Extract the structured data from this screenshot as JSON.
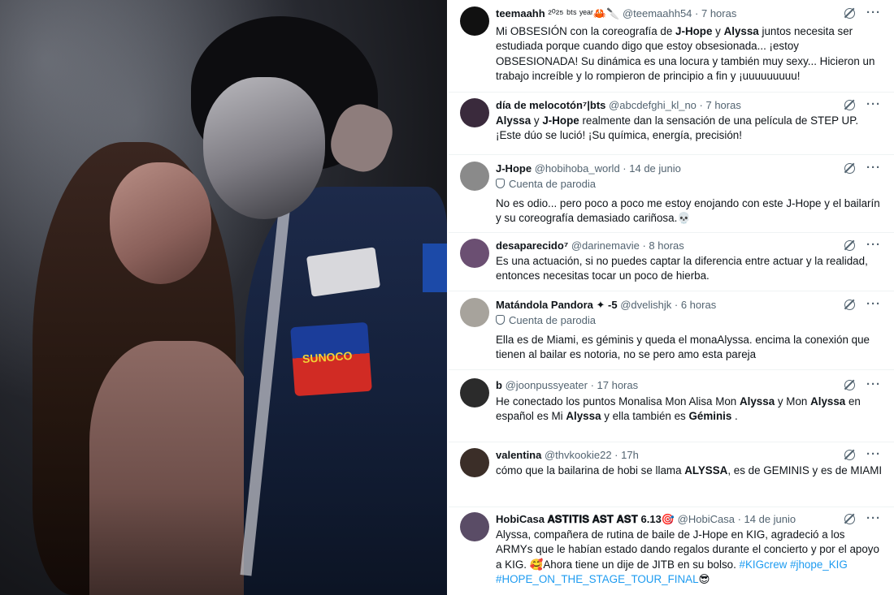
{
  "tweets": [
    {
      "name": "teemaahh",
      "name_suffix": "²⁰²⁵ ᵇᵗˢ ʸᵉᵃʳ🦀🔪",
      "handle": "@teemaahh54",
      "time": "7 horas",
      "parody": "",
      "body": [
        {
          "t": "Mi OBSESIÓN con la coreografía de "
        },
        {
          "t": "J-Hope",
          "b": true
        },
        {
          "t": " y "
        },
        {
          "t": "Alyssa",
          "b": true
        },
        {
          "t": " juntos necesita ser estudiada porque cuando digo que estoy obsesionada... ¡estoy OBSESIONADA! Su dinámica es una locura y también muy sexy... Hicieron un trabajo increíble y lo rompieron de principio a fin y ¡uuuuuuuuu!"
        }
      ],
      "avatar_color": "#111111"
    },
    {
      "name": "día de melocotón⁷|bts",
      "name_suffix": "",
      "handle": "@abcdefghi_kl_no",
      "time": "7 horas",
      "parody": "",
      "body": [
        {
          "t": "Alyssa",
          "b": true
        },
        {
          "t": " y "
        },
        {
          "t": "J-Hope",
          "b": true
        },
        {
          "t": " realmente dan la sensación de una película de STEP UP. ¡Este dúo se lució! ¡Su química, energía, precisión!"
        }
      ],
      "avatar_color": "#3a2a3c"
    },
    {
      "name": "J-Hope",
      "name_suffix": "",
      "handle": "@hobihoba_world",
      "time": "14 de junio",
      "parody": "Cuenta de parodia",
      "body": [
        {
          "t": "No es odio... pero poco a poco me estoy enojando con este J-Hope y el bailarín y su coreografía demasiado cariñosa.💀"
        }
      ],
      "avatar_color": "#8a8a8a"
    },
    {
      "name": "desaparecido⁷",
      "name_suffix": "",
      "handle": "@darinemavie",
      "time": "8 horas",
      "parody": "",
      "body": [
        {
          "t": "Es una actuación, si no puedes captar la diferencia entre actuar y la realidad, entonces necesitas tocar un poco de hierba."
        }
      ],
      "avatar_color": "#6b4f72"
    },
    {
      "name": "Matándola Pandora ✦ -5",
      "name_suffix": "",
      "handle": "@dvelishjk",
      "time": "6 horas",
      "parody": "Cuenta de parodia",
      "body": [
        {
          "t": "Ella es de Miami, es géminis y queda el monaAlyssa. encima la conexión que tienen al bailar es notoria, no se pero amo esta pareja"
        }
      ],
      "avatar_color": "#a7a39c"
    },
    {
      "name": "b",
      "name_suffix": "",
      "handle": "@joonpussyeater",
      "time": "17 horas",
      "parody": "",
      "body": [
        {
          "t": "He conectado los puntos Monalisa Mon Alisa Mon "
        },
        {
          "t": "Alyssa",
          "b": true
        },
        {
          "t": " y Mon "
        },
        {
          "t": "Alyssa",
          "b": true
        },
        {
          "t": " en español es Mi "
        },
        {
          "t": "Alyssa",
          "b": true
        },
        {
          "t": " y ella también es "
        },
        {
          "t": "Géminis",
          "b": true
        },
        {
          "t": " ."
        }
      ],
      "avatar_color": "#2b2b2b"
    },
    {
      "name": "valentina",
      "name_suffix": "",
      "handle": "@thvkookie22",
      "time": "17h",
      "parody": "",
      "body": [
        {
          "t": "cómo que la bailarina de hobi se llama "
        },
        {
          "t": "ALYSSA",
          "b": true
        },
        {
          "t": ", es de GEMINIS y es de MIAMI"
        }
      ],
      "avatar_color": "#3b2e28"
    },
    {
      "name": "HobiCasa 𝐀𝐒𝐓𝐈𝐓𝐈𝐒 𝐀𝐒𝐓 𝐀𝐒𝐓 6.13🎯",
      "name_suffix": "",
      "handle": "@HobiCasa",
      "time": "14 de junio",
      "parody": "",
      "body": [
        {
          "t": "Alyssa, compañera de rutina de baile de J-Hope en KIG, agradeció a los ARMYs que le habían estado dando regalos durante el concierto y por el apoyo a KIG. 🥰Ahora tiene un dije de JITB en su bolso. "
        },
        {
          "t": "#KIGcrew",
          "l": true
        },
        {
          "t": " "
        },
        {
          "t": "#jhope_KIG",
          "l": true
        },
        {
          "t": " "
        },
        {
          "t": "#HOPE_ON_THE_STAGE_TOUR_FINAL",
          "l": true
        },
        {
          "t": "😎"
        }
      ],
      "avatar_color": "#5a4c66"
    }
  ],
  "separator": " · ",
  "more_label": "···",
  "photo_patch_text": "SUNOCO"
}
